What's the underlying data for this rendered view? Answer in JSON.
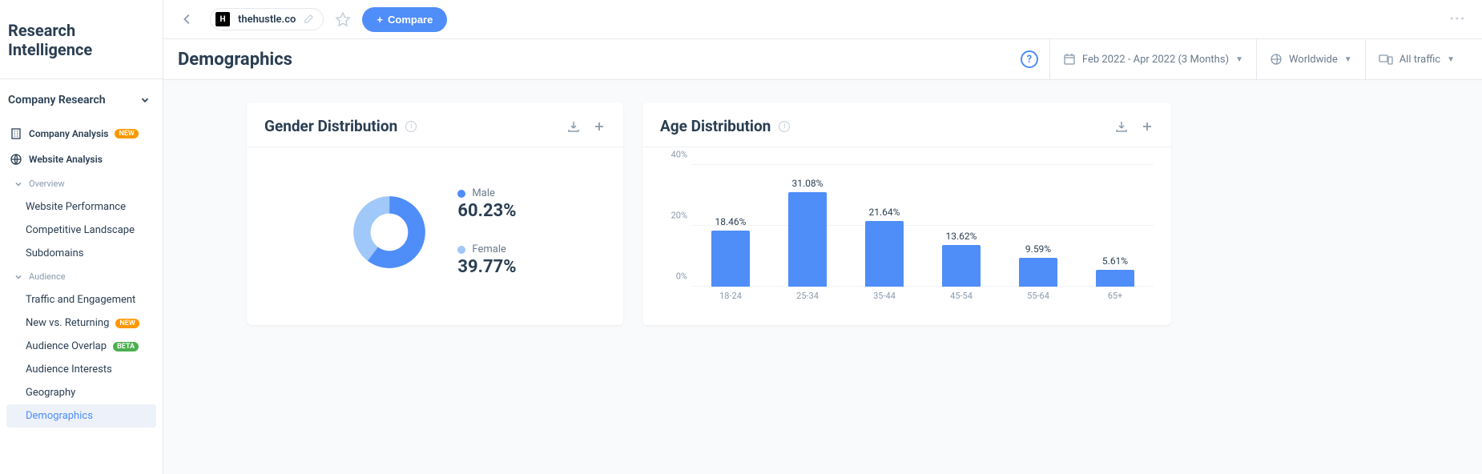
{
  "app_title": "Research Intelligence",
  "sidebar": {
    "section_header": "Company Research",
    "company_analysis": "Company Analysis",
    "website_analysis": "Website Analysis",
    "badge_new": "NEW",
    "badge_beta": "BETA",
    "overview_group": "Overview",
    "overview_items": [
      "Website Performance",
      "Competitive Landscape",
      "Subdomains"
    ],
    "audience_group": "Audience",
    "audience_items": [
      {
        "label": "Traffic and Engagement",
        "badge": null
      },
      {
        "label": "New vs. Returning",
        "badge": "NEW"
      },
      {
        "label": "Audience Overlap",
        "badge": "BETA"
      },
      {
        "label": "Audience Interests",
        "badge": null
      },
      {
        "label": "Geography",
        "badge": null
      },
      {
        "label": "Demographics",
        "badge": null,
        "active": true
      }
    ]
  },
  "topbar": {
    "domain": "thehustle.co",
    "compare": "Compare",
    "favicon_letter": "H"
  },
  "header": {
    "title": "Demographics",
    "date_range": "Feb 2022 - Apr 2022 (3 Months)",
    "region": "Worldwide",
    "traffic": "All traffic"
  },
  "cards": {
    "gender_title": "Gender Distribution",
    "age_title": "Age Distribution"
  },
  "gender": {
    "male_label": "Male",
    "female_label": "Female",
    "male_pct": "60.23%",
    "female_pct": "39.77%",
    "colors": {
      "male": "#4f8df9",
      "female": "#a0c8f8"
    }
  },
  "chart_data": [
    {
      "type": "pie",
      "title": "Gender Distribution",
      "series": [
        {
          "name": "Male",
          "value": 60.23,
          "color": "#4f8df9"
        },
        {
          "name": "Female",
          "value": 39.77,
          "color": "#a0c8f8"
        }
      ]
    },
    {
      "type": "bar",
      "title": "Age Distribution",
      "categories": [
        "18-24",
        "25-34",
        "35-44",
        "45-54",
        "55-64",
        "65+"
      ],
      "values": [
        18.46,
        31.08,
        21.64,
        13.62,
        9.59,
        5.61
      ],
      "xlabel": "",
      "ylabel": "",
      "ylim": [
        0,
        40
      ],
      "y_ticks": [
        "0%",
        "20%",
        "40%"
      ]
    }
  ]
}
